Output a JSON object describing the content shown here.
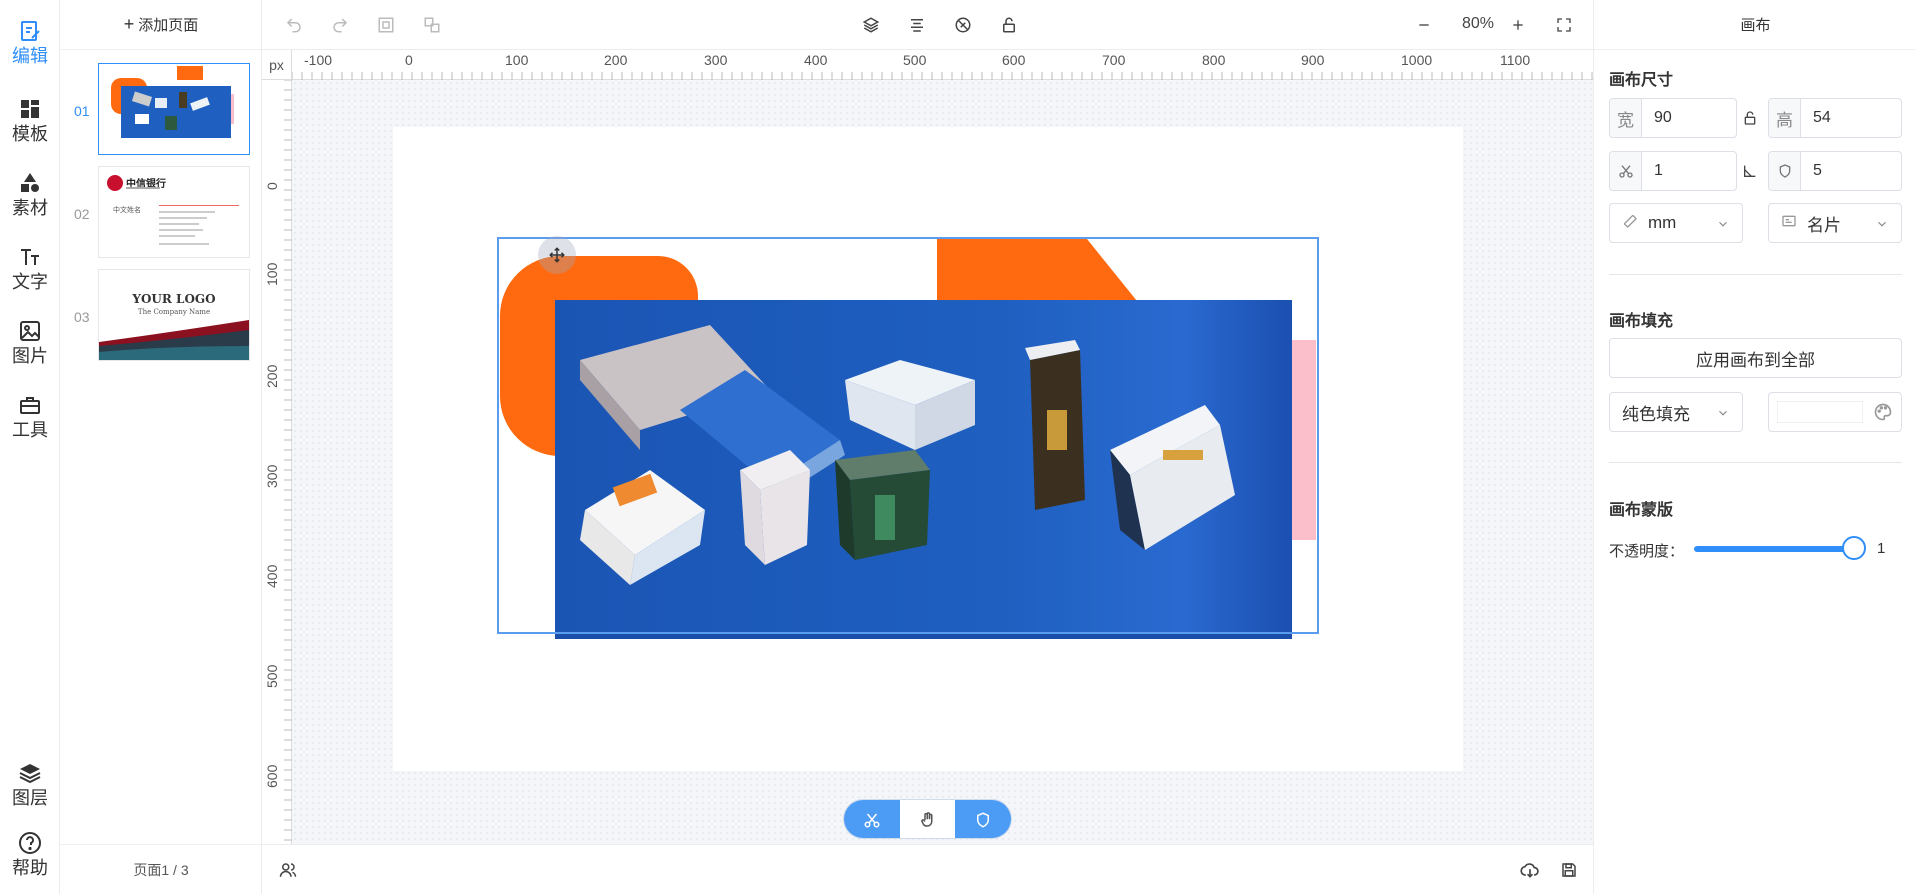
{
  "rail": {
    "edit": "编辑",
    "template": "模板",
    "material": "素材",
    "text": "文字",
    "image": "图片",
    "tools": "工具",
    "layers": "图层",
    "help": "帮助"
  },
  "pages": {
    "add_label": "添加页面",
    "items": [
      {
        "num": "01"
      },
      {
        "num": "02"
      },
      {
        "num": "03"
      }
    ],
    "footer": "页面1 / 3",
    "thumb3_logo": "YOUR LOGO",
    "thumb3_company": "The Company Name",
    "thumb2_bank": "中信银行",
    "thumb2_name": "中文姓名"
  },
  "toolbar": {
    "zoom": "80%"
  },
  "ruler": {
    "unit": "px",
    "h_labels": [
      "-100",
      "0",
      "100",
      "200",
      "300",
      "400",
      "500",
      "600",
      "700",
      "800",
      "900",
      "1000",
      "1100"
    ],
    "v_labels": [
      "0",
      "100",
      "200",
      "300",
      "400",
      "500",
      "600"
    ]
  },
  "right_panel": {
    "title": "画布",
    "size_title": "画布尺寸",
    "width_prefix": "宽",
    "width_value": "90",
    "height_prefix": "高",
    "height_value": "54",
    "bleed_value": "1",
    "safe_value": "5",
    "unit_select": "mm",
    "type_select": "名片",
    "fill_title": "画布填充",
    "apply_all": "应用画布到全部",
    "fill_mode": "纯色填充",
    "mask_title": "画布蒙版",
    "opacity_label": "不透明度：",
    "opacity_value": "1"
  },
  "colors": {
    "accent": "#2f8ef7",
    "orange": "#ff6a10",
    "pink": "#fbbfcb",
    "photo_blue": "#1e5fc0"
  }
}
